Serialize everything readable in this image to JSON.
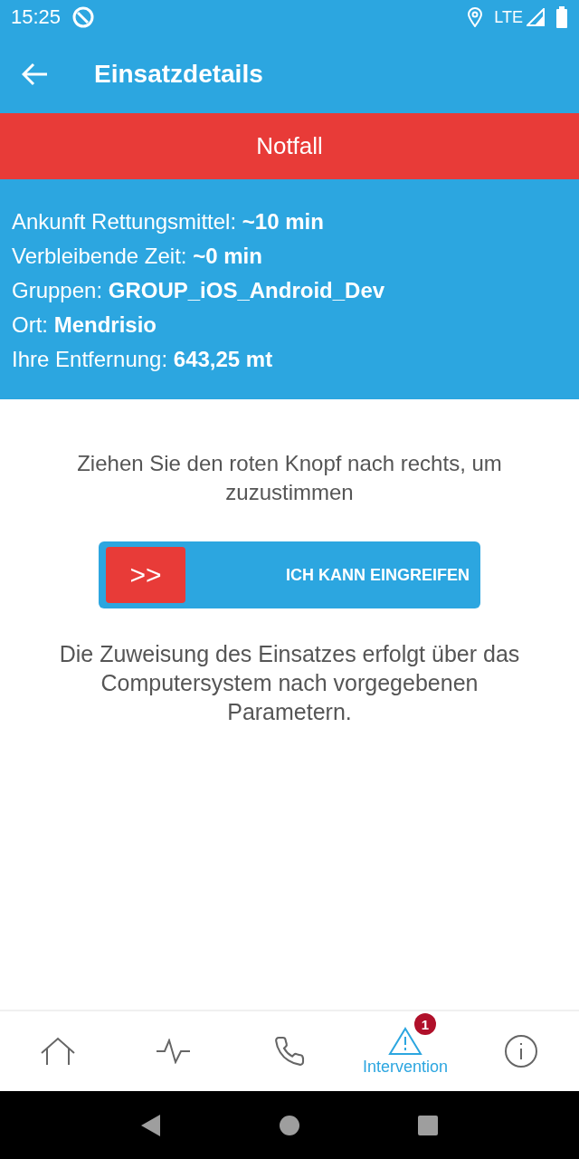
{
  "status_bar": {
    "time": "15:25",
    "network": "LTE"
  },
  "app_bar": {
    "title": "Einsatzdetails"
  },
  "banner": {
    "text": "Notfall"
  },
  "details": [
    "Ankunft Rettungsmittel: **~10 min**",
    "Verbleibende Zeit: **~0 min**",
    "Gruppen: **GROUP_iOS_Android_Dev**",
    "Ort: **Mendrisio**",
    "Ihre Entfernung: **643,25 mt**"
  ],
  "instruction": "Ziehen Sie den roten Knopf nach rechts, um zuzustimmen",
  "swipe_button": {
    "knob": ">>",
    "label": "ICH KANN EINGREIFEN"
  },
  "note": "Die Zuweisung des Einsatzes erfolgt über das Computersystem nach vorgegebenen Parametern.",
  "bottom_nav": [
    {
      "kind": "home",
      "selected": false
    },
    {
      "kind": "activity",
      "selected": false
    },
    {
      "kind": "phone",
      "selected": false
    },
    {
      "kind": "alert",
      "selected": true,
      "label": "Intervention",
      "badge": "1"
    },
    {
      "kind": "info",
      "selected": false
    }
  ]
}
